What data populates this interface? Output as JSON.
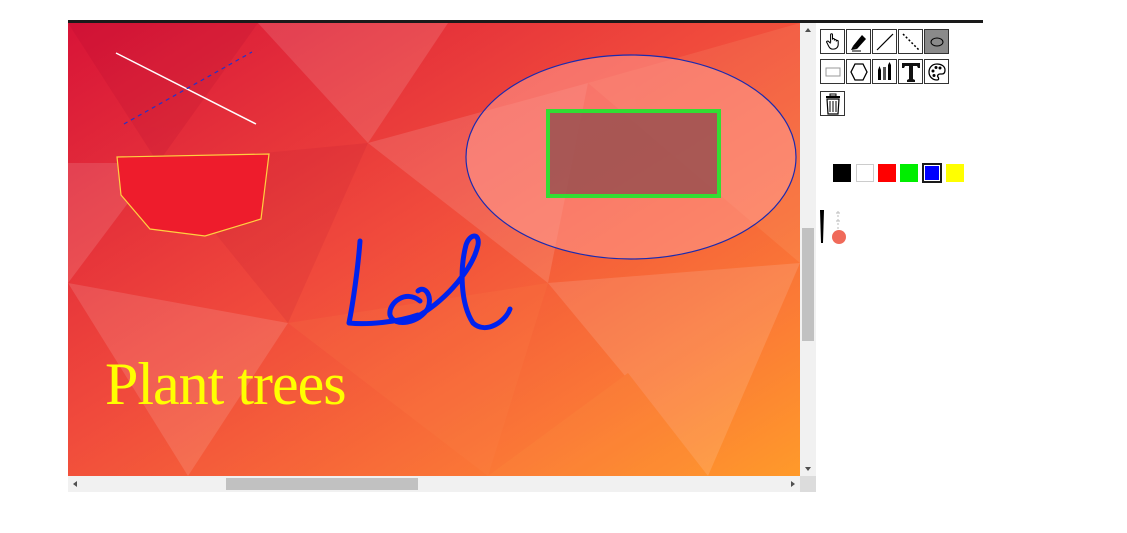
{
  "canvas": {
    "text_label": "Plant trees",
    "text_color": "#ffff00",
    "drawn_text_color": "#0022ee"
  },
  "toolbar": {
    "tools": [
      {
        "name": "hand-tool-button",
        "icon": "hand-pointer-icon",
        "active": false
      },
      {
        "name": "pencil-tool-button",
        "icon": "pencil-icon",
        "active": false
      },
      {
        "name": "line-tool-button",
        "icon": "line-icon",
        "active": false
      },
      {
        "name": "dashed-line-tool-button",
        "icon": "dashed-line-icon",
        "active": false
      },
      {
        "name": "ellipse-tool-button",
        "icon": "ellipse-icon",
        "active": true
      },
      {
        "name": "rectangle-tool-button",
        "icon": "rectangle-icon",
        "active": false
      },
      {
        "name": "polygon-tool-button",
        "icon": "hexagon-icon",
        "active": false
      },
      {
        "name": "brush-tool-button",
        "icon": "brushes-icon",
        "active": false
      },
      {
        "name": "text-tool-button",
        "icon": "text-t-icon",
        "active": false
      },
      {
        "name": "color-palette-button",
        "icon": "palette-icon",
        "active": false
      },
      {
        "name": "clear-button",
        "icon": "trash-icon",
        "active": false
      }
    ]
  },
  "palette": {
    "colors": [
      "#000000",
      "#ffffff",
      "#ff0000",
      "#00ee00",
      "#0000ff",
      "#ffff00"
    ],
    "selected": "#0000ff"
  },
  "brush": {
    "preview_color": "#f06a5a",
    "icon": "brush-size-icon"
  }
}
